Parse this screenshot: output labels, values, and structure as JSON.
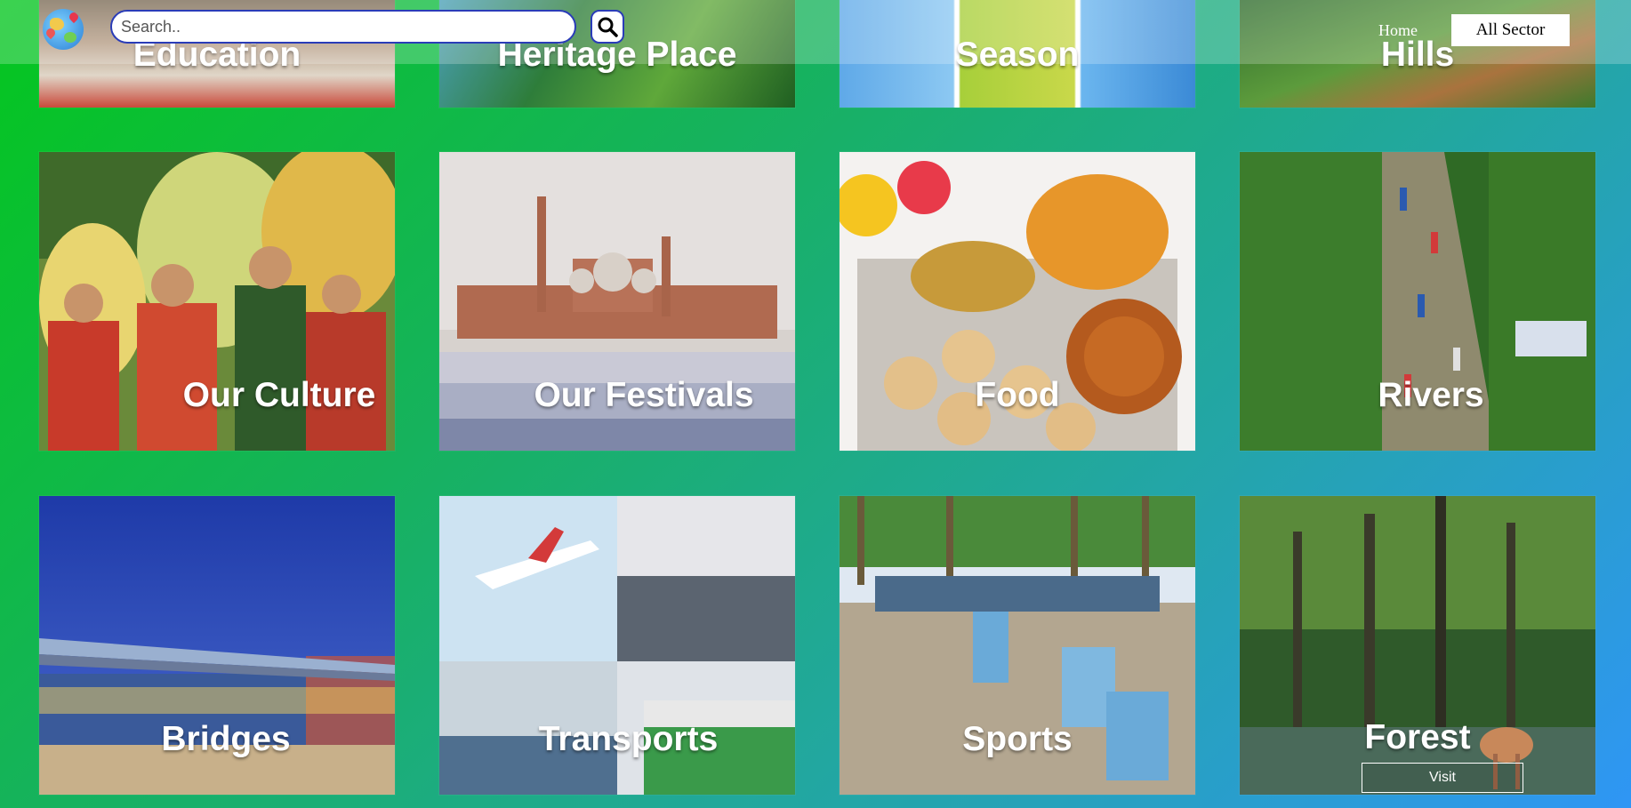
{
  "header": {
    "search_placeholder": "Search..",
    "nav_home": "Home",
    "nav_all_sector": "All Sector"
  },
  "cards_top": [
    {
      "title": "Education"
    },
    {
      "title": "Heritage Place"
    },
    {
      "title": "Season"
    },
    {
      "title": "Hills"
    }
  ],
  "cards_mid": [
    {
      "title": "Our Culture"
    },
    {
      "title": "Our Festivals"
    },
    {
      "title": "Food"
    },
    {
      "title": "Rivers"
    }
  ],
  "cards_bot": [
    {
      "title": "Bridges"
    },
    {
      "title": "Transports"
    },
    {
      "title": "Sports"
    },
    {
      "title": "Forest",
      "button": "Visit"
    }
  ],
  "colors": {
    "background_start": "#04c61e",
    "background_end": "#2f96f5",
    "search_border": "#2a3cb8"
  }
}
